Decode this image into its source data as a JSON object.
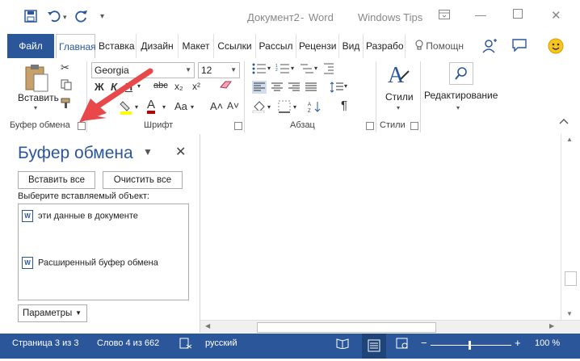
{
  "titlebar": {
    "doc_title": "Документ2",
    "separator": "-",
    "app_name": "Word",
    "brand": "Windows Tips",
    "save_icon": "save-icon",
    "undo_icon": "undo-icon",
    "redo_icon": "redo-icon"
  },
  "tabs": {
    "file": "Файл",
    "items": [
      "Главная",
      "Вставка",
      "Дизайн",
      "Макет",
      "Ссылки",
      "Рассыл",
      "Рецензи",
      "Вид",
      "Разрабо"
    ],
    "tell_me": "Помощн"
  },
  "ribbon": {
    "clipboard": {
      "paste_label": "Вставить",
      "group_label": "Буфер обмена"
    },
    "font": {
      "family": "Georgia",
      "size": "12",
      "bold": "Ж",
      "italic": "К",
      "underline": "Ч",
      "strike": "abc",
      "subscript": "x₂",
      "superscript": "x²",
      "font_color_letter": "A",
      "case": "Aa",
      "grow": "A˄",
      "shrink": "A˅",
      "group_label": "Шрифт"
    },
    "paragraph": {
      "group_label": "Абзац"
    },
    "styles": {
      "label": "Стили",
      "group_label": "Стили"
    },
    "editing": {
      "label": "Редактирование"
    },
    "colors": {
      "accent": "#2b579a",
      "highlight": "#ffff00",
      "font_red": "#c00000"
    }
  },
  "pane": {
    "title": "Буфер обмена",
    "paste_all": "Вставить все",
    "clear_all": "Очистить все",
    "prompt": "Выберите вставляемый объект:",
    "items": [
      {
        "text": "эти данные в документе"
      },
      {
        "text": "Расширенный буфер обмена"
      }
    ],
    "options": "Параметры"
  },
  "status": {
    "page": "Страница 3 из 3",
    "words": "Слово 4 из 662",
    "language": "русский",
    "zoom": "100 %"
  }
}
